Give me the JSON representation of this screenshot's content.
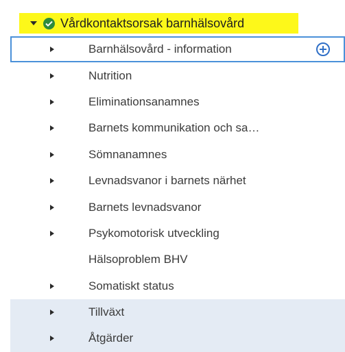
{
  "root": {
    "label": "Vårdkontaktsorsak barnhälsovård",
    "status_icon": "check-circle-icon",
    "highlight_color": "#fdf81a"
  },
  "items": [
    {
      "label": "Barnhälsovård - information",
      "expandable": true,
      "selected": true,
      "action_icon": "plus-circle-icon"
    },
    {
      "label": "Nutrition",
      "expandable": true
    },
    {
      "label": "Eliminationsanamnes",
      "expandable": true
    },
    {
      "label": "Barnets kommunikation och sa…",
      "expandable": true
    },
    {
      "label": "Sömnanamnes",
      "expandable": true
    },
    {
      "label": "Levnadsvanor i barnets närhet",
      "expandable": true
    },
    {
      "label": "Barnets levnadsvanor",
      "expandable": true
    },
    {
      "label": "Psykomotorisk utveckling",
      "expandable": true
    },
    {
      "label": "Hälsoproblem BHV",
      "expandable": false
    },
    {
      "label": "Somatiskt status",
      "expandable": true
    },
    {
      "label": "Tillväxt",
      "expandable": true,
      "shaded": true
    },
    {
      "label": "Åtgärder",
      "expandable": true,
      "shaded": true
    }
  ]
}
